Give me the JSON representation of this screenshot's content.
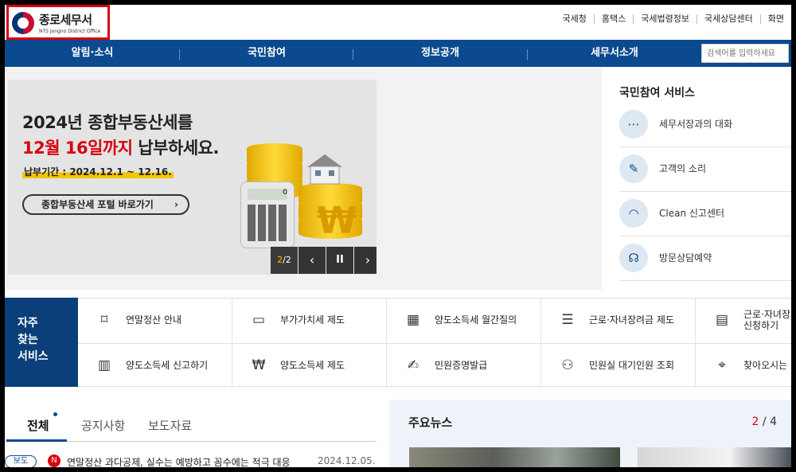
{
  "header": {
    "logo_title": "종로세무서",
    "logo_sub": "NTS Jongno District Office",
    "util_links": [
      "국세청",
      "홈택스",
      "국세법령정보",
      "국세상담센터",
      "화면"
    ]
  },
  "nav": {
    "items": [
      "알림·소식",
      "국민참여",
      "정보공개",
      "세무서소개"
    ],
    "search_placeholder": "검색어를 입력하세요"
  },
  "banner": {
    "line1": "2024년 종합부동산세를",
    "line2_highlight": "12월 16일까지",
    "line2_rest": " 납부하세요.",
    "period": "납부기간 : 2024.12.1 ~ 12.16.",
    "button_label": "종합부동산세 포털 바로가기",
    "button_arrow": "›",
    "calc_display": "0",
    "won_symbol": "₩",
    "slide_current": "2",
    "slide_total": "/2",
    "prev": "‹",
    "pause": "II",
    "next": "›"
  },
  "services": {
    "title": "국민참여 서비스",
    "items": [
      {
        "label": "세무서장과의 대화",
        "icon": "chat-icon"
      },
      {
        "label": "고객의 소리",
        "icon": "pen-icon"
      },
      {
        "label": "Clean 신고센터",
        "icon": "alarm-icon"
      },
      {
        "label": "방문상담예약",
        "icon": "headset-icon"
      }
    ]
  },
  "quick": {
    "title_lines": [
      "자주",
      "찾는",
      "서비스"
    ],
    "row1": [
      {
        "label": "연말정산 안내",
        "icon": "bookmark-icon"
      },
      {
        "label": "부가가치세 제도",
        "icon": "payment-icon"
      },
      {
        "label": "양도소득세 월간질의",
        "icon": "calculator-icon"
      },
      {
        "label": "근로·자녀장려금 제도",
        "icon": "receipt-icon"
      },
      {
        "label": "근로·자녀장려금 신청하기",
        "line1": "근로·자녀장",
        "line2": "신청하기",
        "icon": "document-icon"
      }
    ],
    "row2": [
      {
        "label": "양도소득세 신고하기",
        "icon": "form-icon"
      },
      {
        "label": "양도소득세 제도",
        "icon": "coin-hand-icon"
      },
      {
        "label": "민원증명발급",
        "icon": "certificate-icon"
      },
      {
        "label": "민원실 대기인원 조회",
        "icon": "people-icon"
      },
      {
        "label": "찾아오시는",
        "icon": "location-icon"
      }
    ]
  },
  "notices": {
    "tabs": [
      "전체",
      "공지사항",
      "보도자료"
    ],
    "items": [
      {
        "badge": "보도",
        "new": "N",
        "title": "연말정산 과다공제, 실수는 예방하고 꼼수에는 적극 대응",
        "date": "2024.12.05."
      }
    ]
  },
  "news": {
    "title": "주요뉴스",
    "page_current": "2",
    "page_sep": " / ",
    "page_total": "4"
  },
  "colors": {
    "nav_blue": "#0b4a8f",
    "quick_blue": "#0b3f79",
    "accent_red": "#d7000f",
    "highlight_yellow": "#f5c400"
  }
}
